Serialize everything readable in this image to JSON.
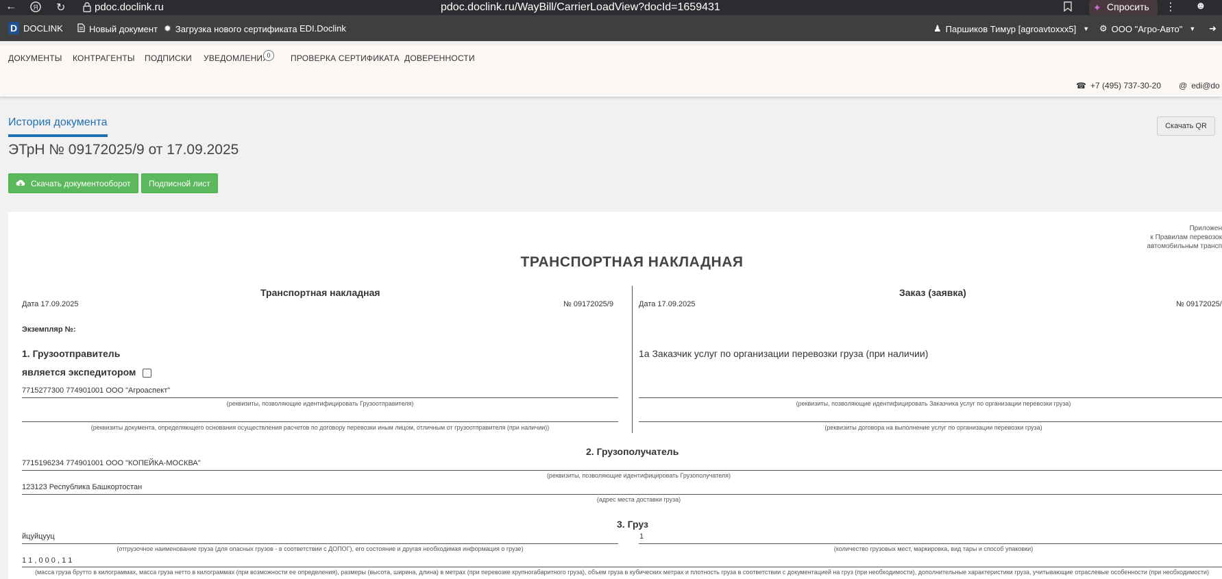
{
  "browser": {
    "site": "pdoc.doclink.ru",
    "url": "pdoc.doclink.ru/WayBill/CarrierLoadView?docId=1659431",
    "ask_label": "Спросить"
  },
  "appbar": {
    "logo_text": "DOCLINK",
    "new_doc": "Новый документ",
    "upload_cert": "Загрузка нового сертификата",
    "edi": "EDI.Doclink",
    "user": "Паршиков Тимур [agroavtoxxx5]",
    "org": "ООО \"Агро-Авто\""
  },
  "subnav": {
    "tabs": [
      "ДОКУМЕНТЫ",
      "КОНТРАГЕНТЫ",
      "ПОДПИСКИ",
      "УВЕДОМЛЕНИЯ",
      "ПРОВЕРКА СЕРТИФИКАТА",
      "ДОВЕРЕННОСТИ"
    ],
    "notif_count": "0",
    "phone": "+7 (495) 737-30-20",
    "email": "edi@do"
  },
  "header": {
    "history_tab": "История документа",
    "doc_title": "ЭТрН №   09172025/9   от   17.09.2025",
    "qr_button": "Скачать QR",
    "download_button": "Скачать документооборот",
    "sign_button": "Подписной лист"
  },
  "sheet": {
    "appendix": [
      "Приложен",
      "к Правилам перевозок",
      "автомобильным трансп"
    ],
    "title": "ТРАНСПОРТНАЯ НАКЛАДНАЯ",
    "left_head": "Транспортная накладная",
    "right_head": "Заказ (заявка)",
    "left_date": "Дата  17.09.2025",
    "left_no": "№    09172025/9",
    "right_date": "Дата 17.09.2025",
    "right_no": "№ 09172025/",
    "copy_no": "Экземпляр №:",
    "s1_title": "1. Грузоотправитель",
    "s1_forwarder": "является экспедитором",
    "s1_value": "7715277300 774901001 ООО \"Агроаспект\"",
    "s1_cap1": "(реквизиты, позволяющие идентифицировать Грузоотправителя)",
    "s1_cap2": "(реквизиты документа, определяющего основания осуществления расчетов по договору перевозки иным лицом, отличным от грузоотправителя (при наличии))",
    "s1a_title": "1а Заказчик услуг по организации перевозки груза (при наличии)",
    "s1a_cap1": "(реквизиты, позволяющие идентифицировать Заказчика услуг по организации перевозки груза)",
    "s1a_cap2": "(реквизиты договора на выполнение услуг по организации перевозки груза)",
    "s2_title": "2. Грузополучатель",
    "s2_value": "7715196234 774901001 ООО \"КОПЕЙКА-МОСКВА\"",
    "s2_cap1": "(реквизиты, позволяющие идентифицировать Грузополучателя)",
    "s2_addr": "123123 Республика Башкортостан",
    "s2_cap2": "(адрес места доставки груза)",
    "s3_title": "3. Груз",
    "s3_name": "йцуйцуyц",
    "s3_name_cap": "(отгрузочное наименование груза (для опасных грузов - в соответствии с ДОПОГ), его состояние и другая необходимая информация о грузе)",
    "s3_qty": "1",
    "s3_qty_cap": "(количество грузовых мест, маркировка, вид тары и способ упаковки)",
    "s3_mass": "1 1 , 0 0 0 , 1 1",
    "s3_mass_cap": "(масса груза брутто в килограммах, масса груза нетто в килограммах (при возможности ее определения), размеры (высота, ширина, длина) в метрах (при перевозке крупногабаритного груза), объем груза в кубических метрах и плотность груза в соответствии с документацией на груз (при необходимости), дополнительные характеристики груза, учитывающие отраслевые особенности (при необходимости)"
  }
}
